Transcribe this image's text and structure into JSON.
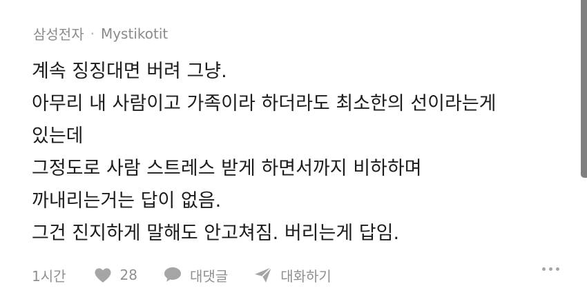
{
  "comment": {
    "company": "삼성전자",
    "separator": "·",
    "author": "Mystikotit",
    "lines": [
      "계속 징징대면 버려 그냥.",
      "아무리 내 사람이고 가족이라 하더라도 최소한의 선이라는게",
      "있는데",
      "그정도로 사람 스트레스 받게 하면서까지 비하하며",
      "까내리는거는 답이 없음.",
      "그건 진지하게 말해도 안고쳐짐. 버리는게 답임."
    ]
  },
  "actions": {
    "time": "1시간",
    "like_count": "28",
    "reply_label": "대댓글",
    "chat_label": "대화하기"
  },
  "icons": {
    "like": "heart-icon",
    "reply": "speech-bubble-icon",
    "chat": "send-icon",
    "more": "more-dots-icon"
  },
  "colors": {
    "text": "#1c1c1c",
    "meta": "#8a8a8a",
    "icon": "#9a9a9a"
  }
}
